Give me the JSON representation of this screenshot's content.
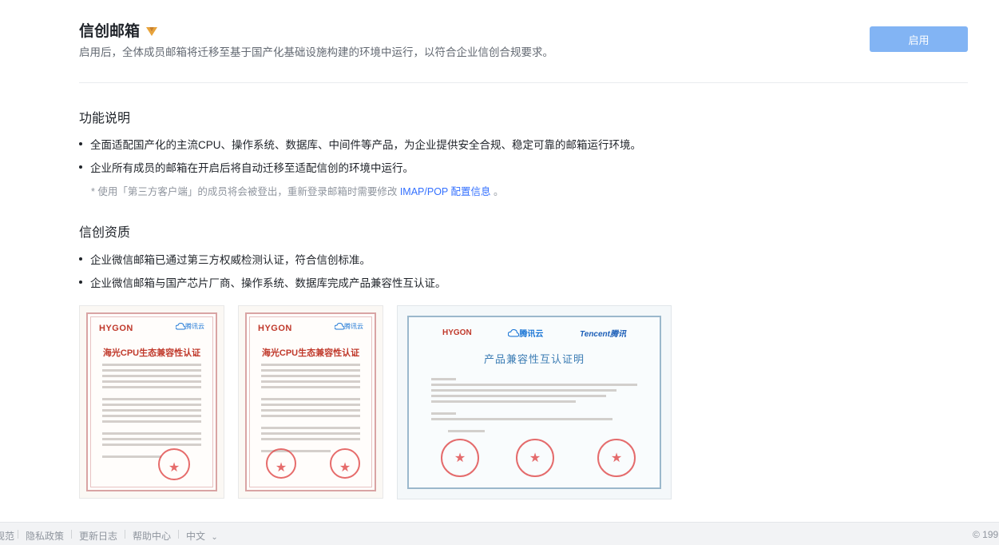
{
  "header": {
    "title": "信创邮箱",
    "subtitle": "启用后，全体成员邮箱将迁移至基于国产化基础设施构建的环境中运行，以符合企业信创合规要求。",
    "enable_label": "启用",
    "accent_color": "#82b4f4"
  },
  "features": {
    "title": "功能说明",
    "bullets": [
      "全面适配国产化的主流CPU、操作系统、数据库、中间件等产品，为企业提供安全合规、稳定可靠的邮箱运行环境。",
      "企业所有成员的邮箱在开启后将自动迁移至适配信创的环境中运行。"
    ],
    "note_prefix": "*   使用「第三方客户端」的成员将会被登出，重新登录邮箱时需要修改",
    "note_link": "IMAP/POP 配置信息",
    "note_suffix": "。"
  },
  "qualification": {
    "title": "信创资质",
    "bullets": [
      "企业微信邮箱已通过第三方权威检测认证，符合信创标准。",
      "企业微信邮箱与国产芯片厂商、操作系统、数据库完成产品兼容性互认证。"
    ]
  },
  "certificates": [
    {
      "brand_left": "HYGON",
      "brand_right": "腾讯云",
      "title": "海光CPU生态兼容性认证"
    },
    {
      "brand_left": "HYGON",
      "brand_right": "腾讯云",
      "title": "海光CPU生态兼容性认证"
    },
    {
      "brand_left": "HYGON",
      "brand_mid": "腾讯云",
      "brand_right": "Tencent腾讯",
      "title": "产品兼容性互认证明"
    }
  ],
  "footer": {
    "items": [
      "规范",
      "隐私政策",
      "更新日志",
      "帮助中心",
      "中文"
    ],
    "copyright": "© 199"
  }
}
